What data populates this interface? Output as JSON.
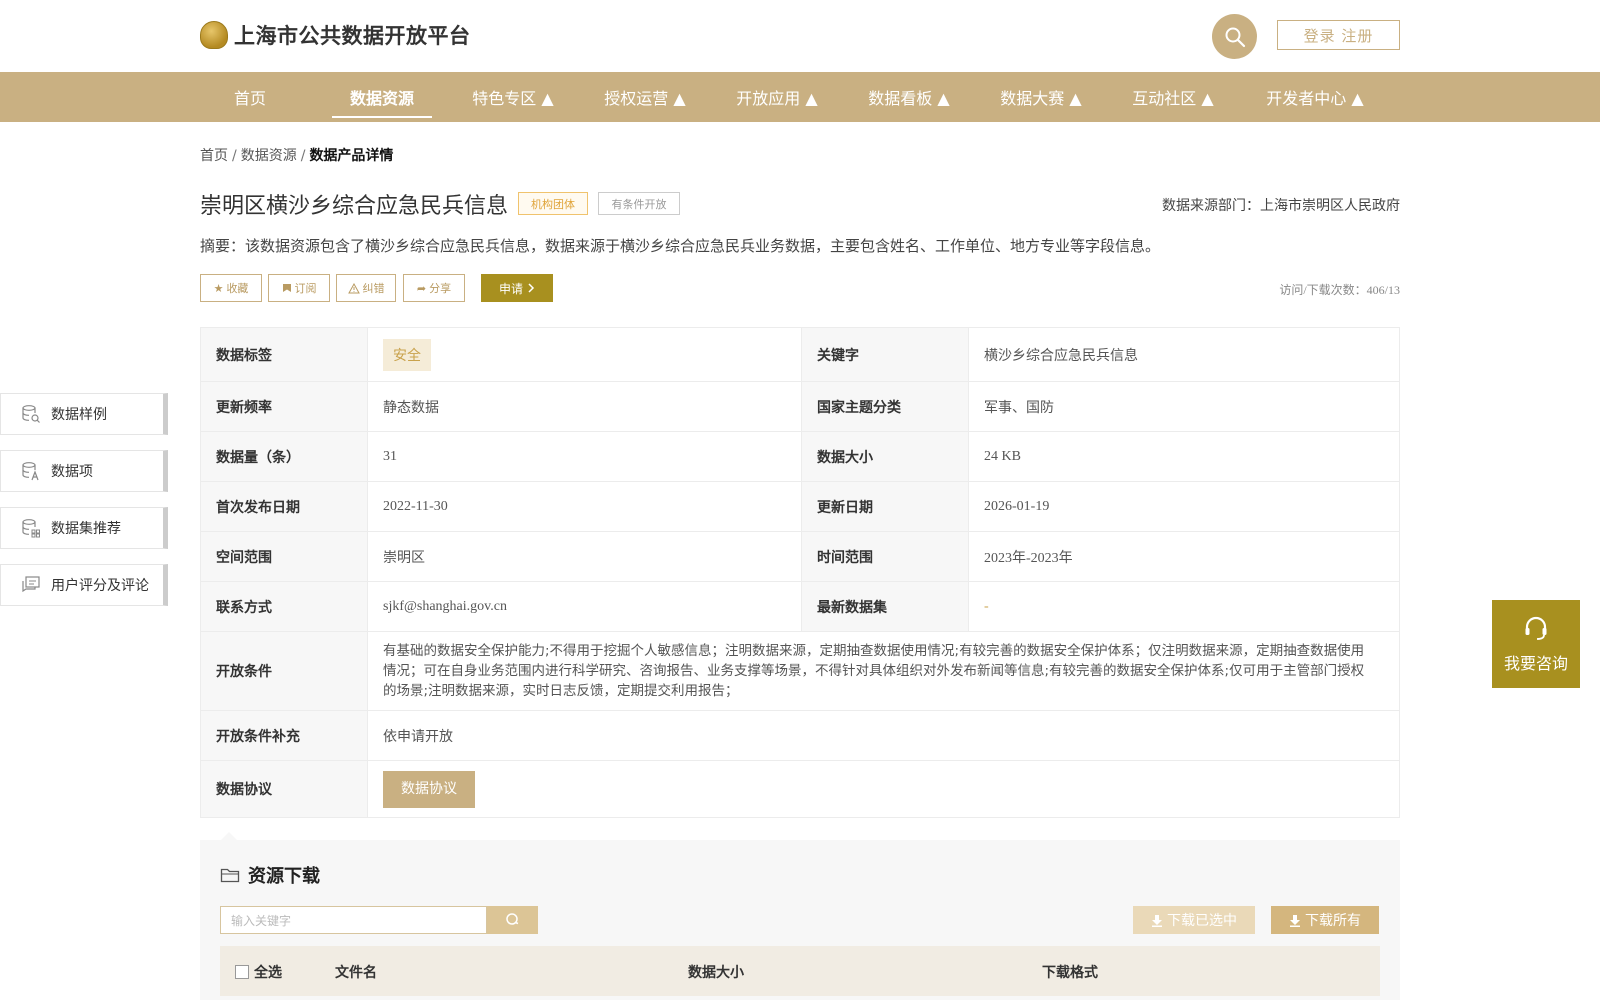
{
  "header": {
    "site_title": "上海市公共数据开放平台",
    "login_label": "登录 注册"
  },
  "nav": {
    "items": [
      {
        "label": "首页"
      },
      {
        "label": "数据资源"
      },
      {
        "label": "特色专区 ▲"
      },
      {
        "label": "授权运营 ▲"
      },
      {
        "label": "开放应用 ▲"
      },
      {
        "label": "数据看板 ▲"
      },
      {
        "label": "数据大赛 ▲"
      },
      {
        "label": "互动社区 ▲"
      },
      {
        "label": "开发者中心 ▲"
      }
    ],
    "active_index": 1
  },
  "breadcrumb": {
    "home": "首页",
    "level1": "数据资源",
    "current": "数据产品详情",
    "separator": "/"
  },
  "dataset": {
    "title": "崇明区横沙乡综合应急民兵信息",
    "tag_org": "机构团体",
    "tag_open": "有条件开放",
    "source": "数据来源部门：上海市崇明区人民政府",
    "summary": "摘要：该数据资源包含了横沙乡综合应急民兵信息，数据来源于横沙乡综合应急民兵业务数据，主要包含姓名、工作单位、地方专业等字段信息。",
    "visits": "访问/下载次数：406/13"
  },
  "actions": {
    "favorite": "收藏",
    "subscribe": "订阅",
    "report": "纠错",
    "share": "分享",
    "apply": "申请"
  },
  "side_menu": [
    {
      "label": "数据样例",
      "icon": "database-search-icon"
    },
    {
      "label": "数据项",
      "icon": "database-text-icon"
    },
    {
      "label": "数据集推荐",
      "icon": "database-grid-icon"
    },
    {
      "label": "用户评分及评论",
      "icon": "comment-icon"
    }
  ],
  "info": {
    "tag_label": "数据标签",
    "tag_value": "安全",
    "keyword_label": "关键字",
    "keyword_value": "横沙乡综合应急民兵信息",
    "freq_label": "更新频率",
    "freq_value": "静态数据",
    "theme_label": "国家主题分类",
    "theme_value": "军事、国防",
    "count_label": "数据量（条）",
    "count_value": "31",
    "size_label": "数据大小",
    "size_value": "24 KB",
    "first_pub_label": "首次发布日期",
    "first_pub_value": "2022-11-30",
    "update_label": "更新日期",
    "update_value": "2026-01-19",
    "space_label": "空间范围",
    "space_value": "崇明区",
    "time_label": "时间范围",
    "time_value": "2023年-2023年",
    "contact_label": "联系方式",
    "contact_value": "sjkf@shanghai.gov.cn",
    "latest_label": "最新数据集",
    "latest_value": "-",
    "cond_label": "开放条件",
    "cond_value": "有基础的数据安全保护能力;不得用于挖掘个人敏感信息；注明数据来源，定期抽查数据使用情况;有较完善的数据安全保护体系；仅注明数据来源，定期抽查数据使用情况；可在自身业务范围内进行科学研究、咨询报告、业务支撑等场景，不得针对具体组织对外发布新闻等信息;有较完善的数据安全保护体系;仅可用于主管部门授权的场景;注明数据来源，实时日志反馈，定期提交利用报告；",
    "cond_extra_label": "开放条件补充",
    "cond_extra_value": "依申请开放",
    "agreement_label": "数据协议",
    "agreement_button": "数据协议"
  },
  "download": {
    "title": "资源下载",
    "search_placeholder": "输入关键字",
    "download_selected": "下载已选中",
    "download_all": "下载所有",
    "col_select_all": "全选",
    "col_filename": "文件名",
    "col_size": "数据大小",
    "col_format": "下载格式"
  },
  "consult": {
    "label": "我要咨询"
  },
  "colors": {
    "brand": "#c9b082",
    "accent_dark": "#a8901f"
  }
}
